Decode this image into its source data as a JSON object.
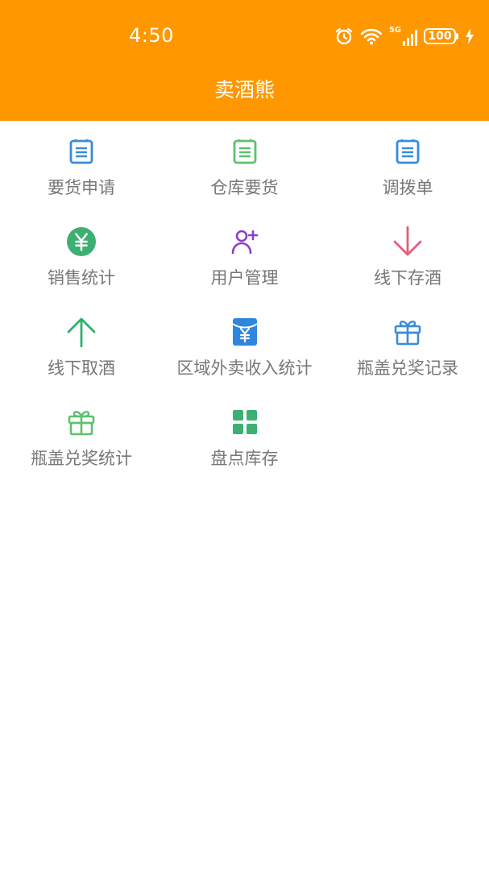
{
  "status_bar": {
    "time": "4:50",
    "network": "5G",
    "battery": "100",
    "icons": [
      "alarm-icon",
      "wifi-icon",
      "signal-5g-icon",
      "battery-icon",
      "charging-icon"
    ]
  },
  "header": {
    "title": "卖酒熊",
    "background_color": "#FF9700"
  },
  "menu": {
    "items": [
      {
        "label": "要货申请",
        "icon": "document-list-icon",
        "color": "#3B8BD9"
      },
      {
        "label": "仓库要货",
        "icon": "document-list-icon",
        "color": "#5CC16D"
      },
      {
        "label": "调拨单",
        "icon": "document-list-icon",
        "color": "#3B8BD9"
      },
      {
        "label": "销售统计",
        "icon": "yuan-circle-icon",
        "color": "#3DAF72"
      },
      {
        "label": "用户管理",
        "icon": "add-user-icon",
        "color": "#8B3FC9"
      },
      {
        "label": "线下存酒",
        "icon": "arrow-down-icon",
        "color": "#E0607A"
      },
      {
        "label": "线下取酒",
        "icon": "arrow-up-icon",
        "color": "#2DB36A"
      },
      {
        "label": "区域外卖收入统计",
        "icon": "red-envelope-icon",
        "color": "#2E86DE"
      },
      {
        "label": "瓶盖兑奖记录",
        "icon": "gift-icon",
        "color": "#3B8BD9"
      },
      {
        "label": "瓶盖兑奖统计",
        "icon": "gift-icon",
        "color": "#5CC16D"
      },
      {
        "label": "盘点库存",
        "icon": "grid-icon",
        "color": "#3DAF72"
      }
    ]
  }
}
